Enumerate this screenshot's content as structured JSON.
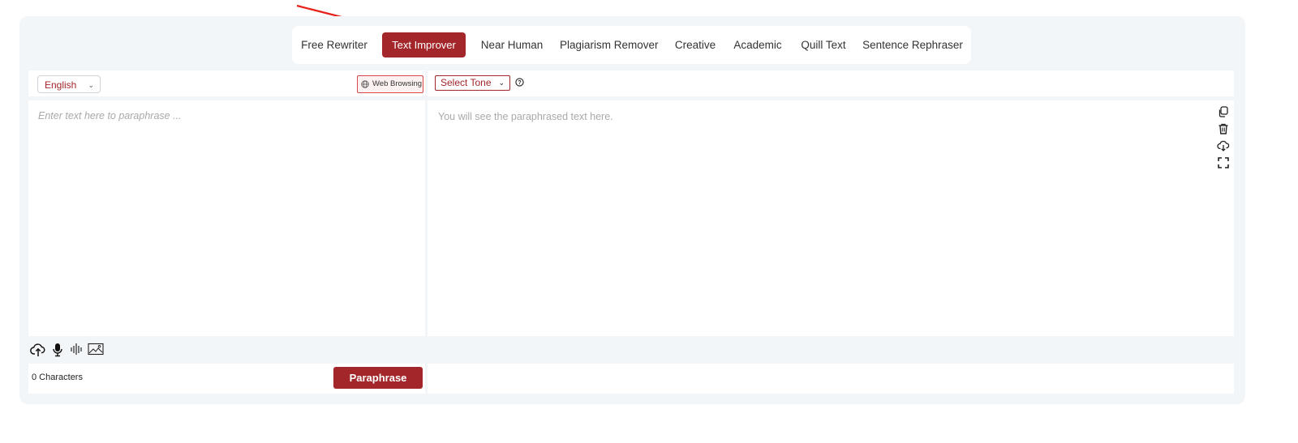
{
  "tabs": [
    {
      "label": "Free Rewriter",
      "active": false
    },
    {
      "label": "Text Improver",
      "active": true
    },
    {
      "label": "Near Human",
      "active": false
    },
    {
      "label": "Plagiarism Remover",
      "active": false
    },
    {
      "label": "Creative",
      "active": false
    },
    {
      "label": "Academic",
      "active": false
    },
    {
      "label": "Quill Text",
      "active": false
    },
    {
      "label": "Sentence Rephraser",
      "active": false
    }
  ],
  "input": {
    "language": "English",
    "web_browsing_label": "Web Browsing",
    "placeholder": "Enter text here to paraphrase ...",
    "char_count": "0 Characters",
    "paraphrase_label": "Paraphrase",
    "tools": [
      "upload-cloud-icon",
      "microphone-icon",
      "audio-wave-icon",
      "image-icon"
    ]
  },
  "output": {
    "tone_label": "Select Tone",
    "placeholder": "You will see the paraphrased text here.",
    "tools": [
      "copy-icon",
      "trash-icon",
      "download-cloud-icon",
      "fullscreen-icon"
    ]
  },
  "colors": {
    "accent": "#a3262a",
    "panel_bg": "#f3f6f9",
    "annotation_arrow": "#e8221b"
  }
}
